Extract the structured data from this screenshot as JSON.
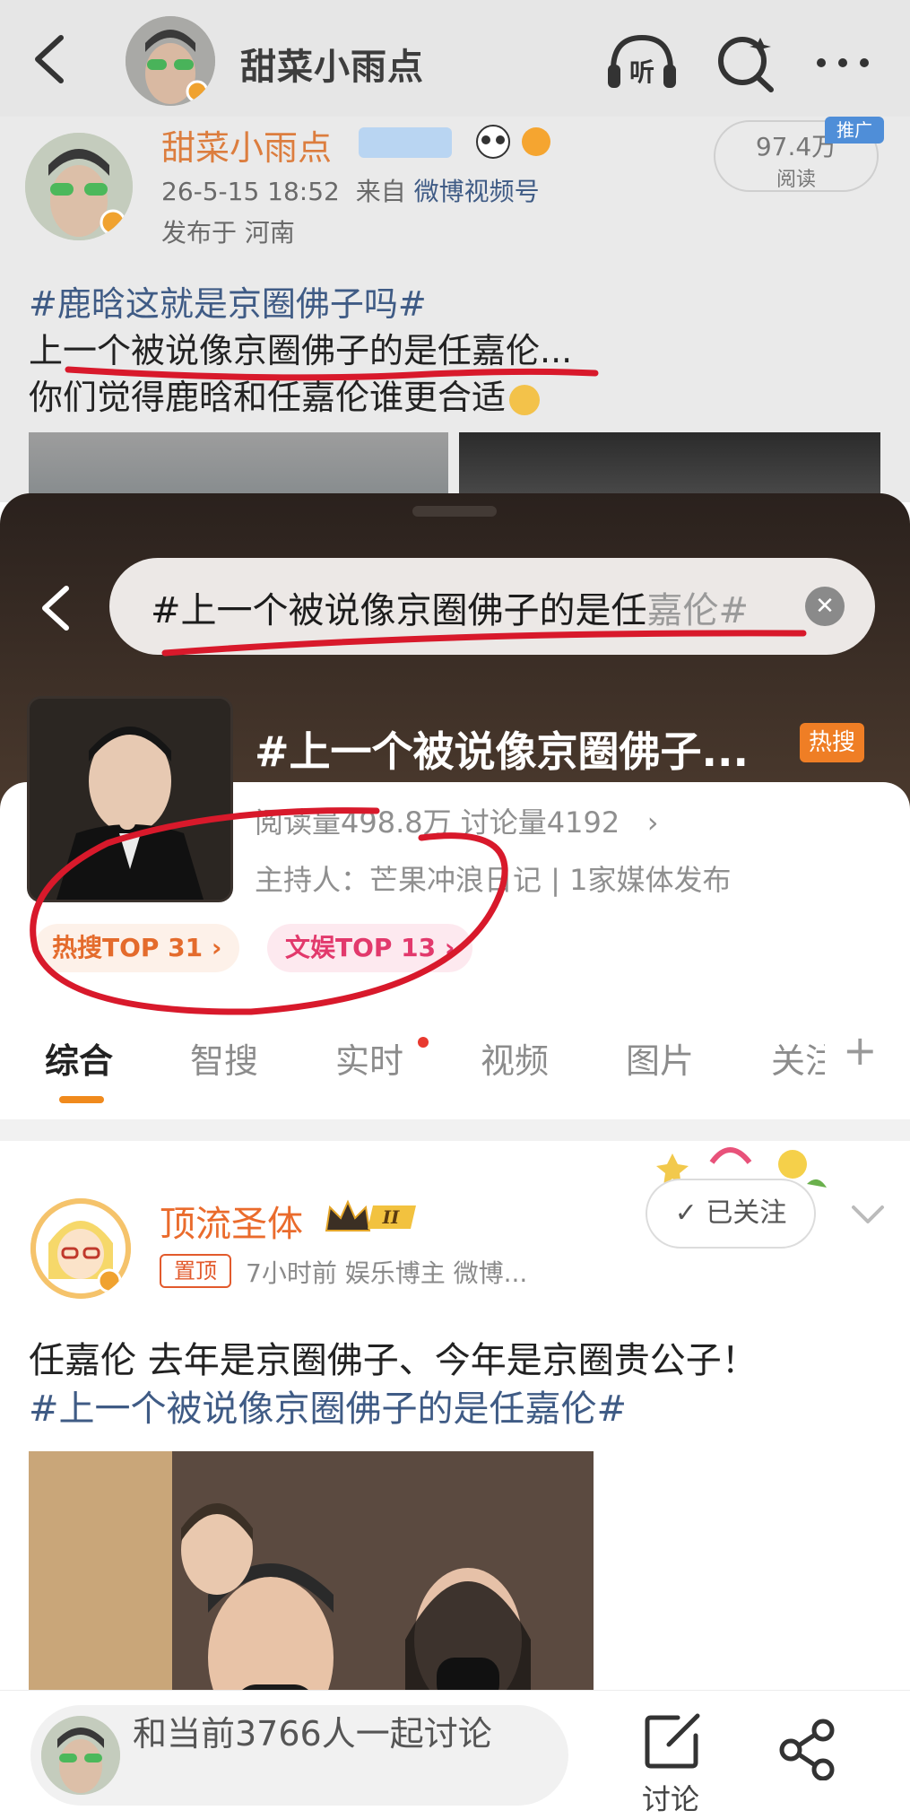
{
  "nav": {
    "title": "甜菜小雨点",
    "back_icon": "back-arrow-icon",
    "listen_label": "听",
    "colors": {
      "bar": "#e6e6e6"
    }
  },
  "original_post": {
    "author": "甜菜小雨点",
    "time": "26-5-15 18:52",
    "via_prefix": "来自",
    "source": "微博视频号",
    "location": "发布于 河南",
    "reads_value": "97.4万",
    "reads_label": "阅读",
    "promo_badge": "推广",
    "hashtag": "#鹿晗这就是京圈佛子吗#",
    "line2": "上一个被说像京圈佛子的是任嘉伦...",
    "line3": "你们觉得鹿晗和任嘉伦谁更合适"
  },
  "topic_sheet": {
    "search_query": "#上一个被说像京圈佛子的是任",
    "search_query_fade": "嘉伦#",
    "topic_title": "#上一个被说像京圈佛子...",
    "hot_badge": "热搜",
    "stats": "阅读量498.8万  讨论量4192",
    "host": "主持人：芒果冲浪日记 | 1家媒体发布",
    "chips": [
      "热搜TOP 31",
      "文娱TOP 13"
    ],
    "tabs": [
      "综合",
      "智搜",
      "实时",
      "视频",
      "图片",
      "关注"
    ],
    "active_tab": "综合",
    "accent": "#f08a1d"
  },
  "feed_post": {
    "author": "顶流圣体",
    "level_badge": "II",
    "pin_label": "置顶",
    "meta": "7小时前  娱乐博主 微博...",
    "follow_label": "已关注",
    "content_line1": "任嘉伦 去年是京圈佛子、今年是京圈贵公子！",
    "content_line2": "#上一个被说像京圈佛子的是任嘉伦#"
  },
  "bottom_bar": {
    "input_placeholder": "和当前3766人一起讨论",
    "discuss_label": "讨论",
    "share_icon": "share-icon"
  }
}
